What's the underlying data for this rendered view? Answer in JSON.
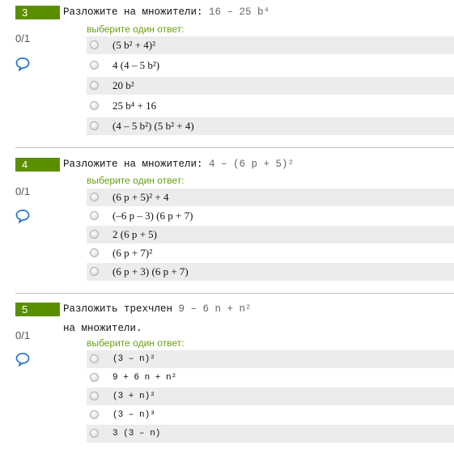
{
  "questions": [
    {
      "number": "3",
      "title_prefix": "Разложите на множители:",
      "expression": "16 – 25 b⁴",
      "grade": "0/1",
      "prompt": "выберите один ответ:",
      "options": [
        "(5 b² + 4)²",
        "4 (4 – 5 b²)",
        "20 b²",
        "25 b⁴ + 16",
        "(4 – 5 b²) (5 b² + 4)"
      ]
    },
    {
      "number": "4",
      "title_prefix": "Разложите на множители:",
      "expression": "4 – (6 p + 5)²",
      "grade": "0/1",
      "prompt": "выберите один ответ:",
      "options": [
        "(6 p + 5)² + 4",
        "(–6 p – 3) (6 p + 7)",
        "2 (6 p + 5)",
        "(6 p + 7)²",
        "(6 p + 3) (6 p + 7)"
      ]
    },
    {
      "number": "5",
      "title_prefix": "Разложить трехчлен",
      "expression": "9 – 6 n + n²",
      "title_line2": "на множители.",
      "grade": "0/1",
      "prompt": "выберите один ответ:",
      "options": [
        "(3 – n)²",
        "9 + 6 n + n²",
        "(3 + n)²",
        "(3 – n)³",
        "3 (3 – n)"
      ]
    }
  ]
}
